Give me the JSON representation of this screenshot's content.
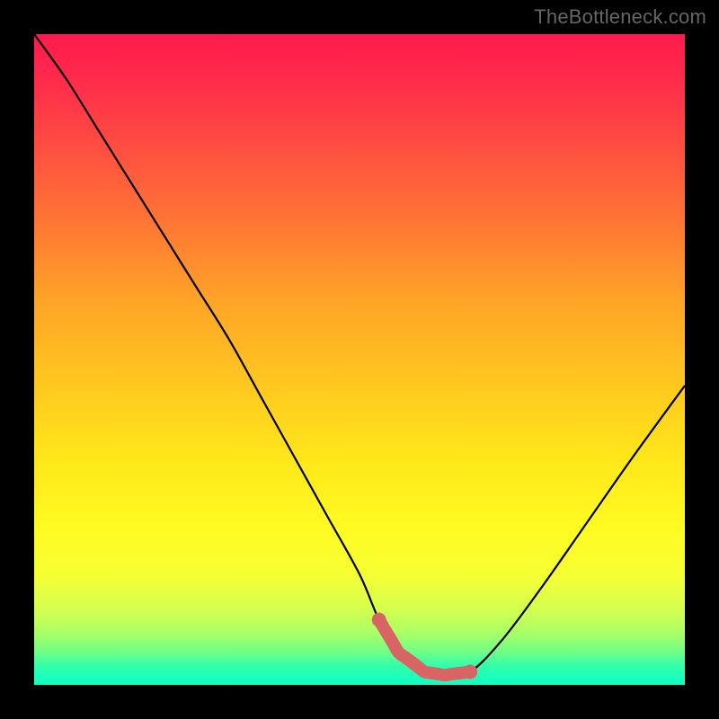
{
  "watermark": "TheBottleneck.com",
  "chart_data": {
    "type": "line",
    "title": "",
    "xlabel": "",
    "ylabel": "",
    "xlim": [
      0,
      100
    ],
    "ylim": [
      0,
      100
    ],
    "grid": false,
    "legend": false,
    "series": [
      {
        "name": "curve",
        "x": [
          0,
          5,
          10,
          15,
          20,
          25,
          30,
          35,
          40,
          45,
          50,
          53,
          56,
          60,
          63,
          67,
          72,
          78,
          85,
          92,
          100
        ],
        "y": [
          100,
          93,
          85,
          77,
          69,
          61,
          53,
          44,
          35,
          26,
          17,
          10,
          5,
          2,
          1.5,
          2,
          7,
          15,
          25,
          35,
          46
        ]
      }
    ],
    "highlight_range_x": [
      53,
      67
    ],
    "background_gradient": {
      "top": "#ff1a4d",
      "mid": "#ffe61a",
      "bottom": "#12ffc4"
    }
  }
}
